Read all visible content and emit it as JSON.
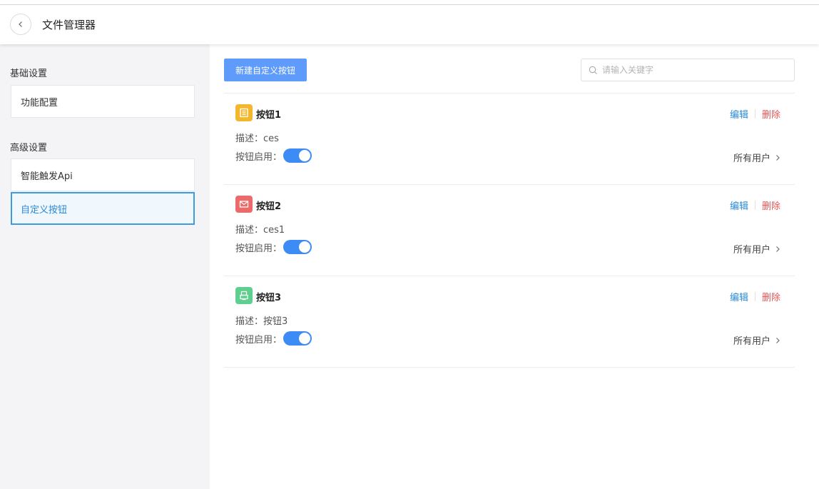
{
  "header": {
    "title": "文件管理器"
  },
  "sidebar": {
    "groups": [
      {
        "title": "基础设置",
        "items": [
          {
            "label": "功能配置"
          }
        ]
      },
      {
        "title": "高级设置",
        "items": [
          {
            "label": "智能触发Api"
          },
          {
            "label": "自定义按钮",
            "active": true
          }
        ]
      }
    ]
  },
  "toolbar": {
    "new_button_label": "新建自定义按钮",
    "search_placeholder": "请输入关键字"
  },
  "buttons": [
    {
      "name": "按钮1",
      "icon": "list-icon",
      "icon_color": "#f2b72d",
      "description": "描述：ces",
      "toggle_label": "按钮启用：",
      "enabled": true,
      "scope": "所有用户",
      "edit": "编辑",
      "delete": "删除"
    },
    {
      "name": "按钮2",
      "icon": "mail-icon",
      "icon_color": "#ec6a6a",
      "description": "描述：ces1",
      "toggle_label": "按钮启用：",
      "enabled": true,
      "scope": "所有用户",
      "edit": "编辑",
      "delete": "删除"
    },
    {
      "name": "按钮3",
      "icon": "print-icon",
      "icon_color": "#5fcf8f",
      "description": "描述：按钮3",
      "toggle_label": "按钮启用：",
      "enabled": true,
      "scope": "所有用户",
      "edit": "编辑",
      "delete": "删除"
    }
  ],
  "colors": {
    "accent": "#2a8ad8",
    "primary_button": "#5e9bfb",
    "toggle_on": "#3d8bf5",
    "danger": "#e45555"
  }
}
